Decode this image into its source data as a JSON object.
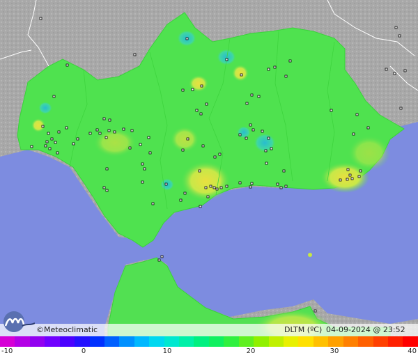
{
  "brand": {
    "symbol": "©",
    "name": "Meteoclimatic"
  },
  "footer": {
    "variable": "DLTM (ºC)",
    "timestamp": "04-09-2024 @ 23:52 UTC"
  },
  "scale": {
    "min": -10,
    "max": 40,
    "ticks": [
      {
        "value": -10,
        "label": "-10"
      },
      {
        "value": 0,
        "label": "0"
      },
      {
        "value": 10,
        "label": "10"
      },
      {
        "value": 20,
        "label": "20"
      },
      {
        "value": 30,
        "label": "30"
      },
      {
        "value": 40,
        "label": "40"
      }
    ],
    "colors": [
      "#d600d6",
      "#b400e6",
      "#9200f0",
      "#7000ff",
      "#4a00ff",
      "#2410ff",
      "#0030ff",
      "#0060ff",
      "#0090ff",
      "#00b8ff",
      "#00d8f0",
      "#00e8d0",
      "#00f0a8",
      "#00f080",
      "#10f060",
      "#30f040",
      "#60f020",
      "#90f000",
      "#c0f000",
      "#e8f000",
      "#ffe000",
      "#ffc000",
      "#ffa000",
      "#ff8000",
      "#ff6000",
      "#ff4000",
      "#ff2000",
      "#ff0000"
    ]
  },
  "colors": {
    "sea": "#7d8ce0",
    "outside_land": "#a9a9a9",
    "region_fill": "#50e050",
    "warm_spot": "#d8e040",
    "cool_spot": "#30c8c8",
    "africa_fill": "#52e052"
  },
  "legend": {
    "logo_icon": "meteoclimatic-logo-icon"
  }
}
